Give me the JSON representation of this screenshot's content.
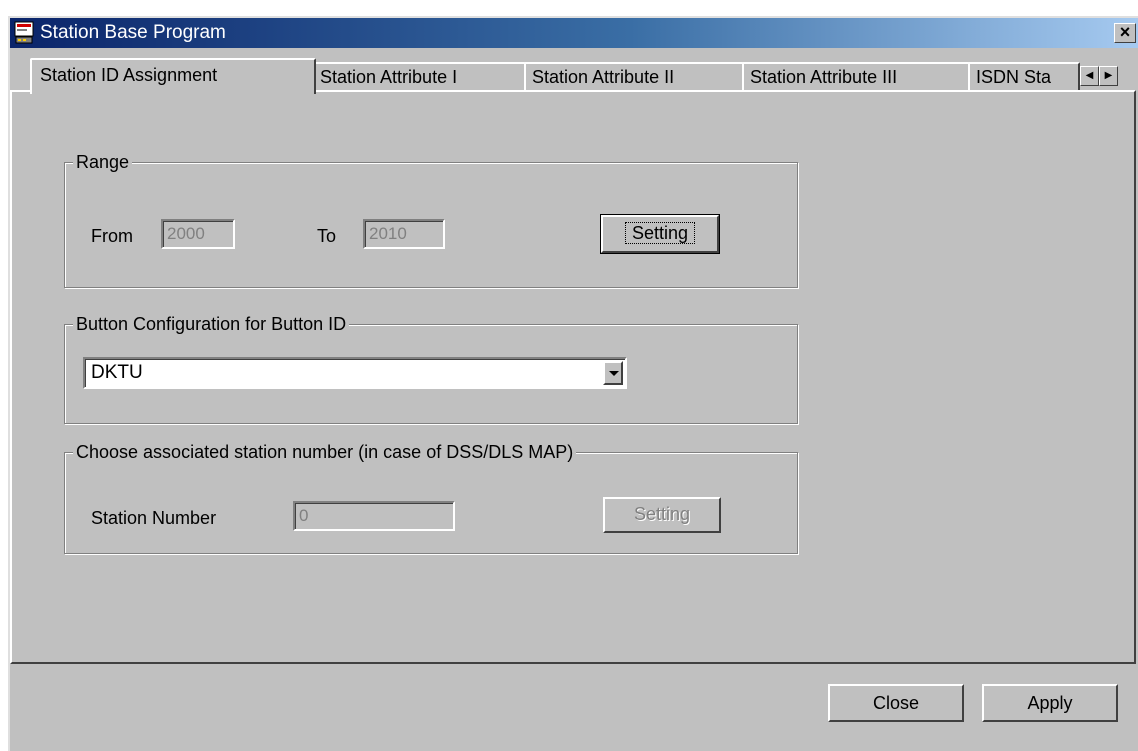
{
  "window": {
    "title": "Station Base Program",
    "close_glyph": "×"
  },
  "tabs": [
    {
      "label": "Station ID Assignment",
      "active": true
    },
    {
      "label": "Station Attribute I"
    },
    {
      "label": "Station Attribute II"
    },
    {
      "label": "Station Attribute III"
    },
    {
      "label": "ISDN Sta"
    }
  ],
  "tab_scroll": {
    "left": "◀",
    "right": "▶"
  },
  "range": {
    "legend": "Range",
    "from_label": "From",
    "from_value": "2000",
    "to_label": "To",
    "to_value": "2010",
    "setting_label": "Setting"
  },
  "button_config": {
    "legend": "Button Configuration for Button ID",
    "selected": "DKTU"
  },
  "assoc": {
    "legend": "Choose associated station number (in case of DSS/DLS MAP)",
    "station_label": "Station Number",
    "station_value": "0",
    "setting_label": "Setting"
  },
  "footer": {
    "close_label": "Close",
    "apply_label": "Apply"
  },
  "colors": {
    "face": "#c0c0c0",
    "title_start": "#0a246a",
    "title_end": "#a6caf0"
  }
}
